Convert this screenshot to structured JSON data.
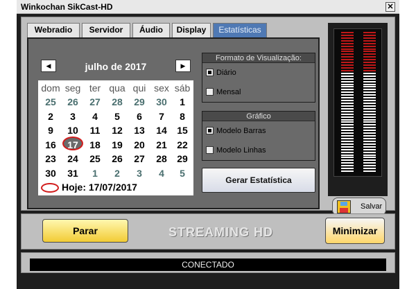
{
  "window": {
    "title": "Winkochan SikCast-HD",
    "close_icon": "close-icon"
  },
  "tabs": [
    {
      "label": "Webradio",
      "active": false
    },
    {
      "label": "Servidor",
      "active": false
    },
    {
      "label": "Áudio",
      "active": false
    },
    {
      "label": "Display",
      "active": false
    },
    {
      "label": "Estatísticas",
      "active": true
    }
  ],
  "calendar": {
    "prev_icon": "chevron-left-icon",
    "next_icon": "chevron-right-icon",
    "month": "julho de 2017",
    "weekdays": [
      "dom",
      "seg",
      "ter",
      "qua",
      "qui",
      "sex",
      "sáb"
    ],
    "weeks": [
      [
        "25",
        "26",
        "27",
        "28",
        "29",
        "30",
        "1"
      ],
      [
        "2",
        "3",
        "4",
        "5",
        "6",
        "7",
        "8"
      ],
      [
        "9",
        "10",
        "11",
        "12",
        "13",
        "14",
        "15"
      ],
      [
        "16",
        "17",
        "18",
        "19",
        "20",
        "21",
        "22"
      ],
      [
        "23",
        "24",
        "25",
        "26",
        "27",
        "28",
        "29"
      ],
      [
        "30",
        "31",
        "1",
        "2",
        "3",
        "4",
        "5"
      ]
    ],
    "today": "Hoje: 17/07/2017"
  },
  "formato": {
    "title": "Formato de Visualização:",
    "options": [
      {
        "label": "Diário",
        "checked": true
      },
      {
        "label": "Mensal",
        "checked": false
      }
    ]
  },
  "grafico": {
    "title": "Gráfico",
    "options": [
      {
        "label": "Modelo Barras",
        "checked": true
      },
      {
        "label": "Modelo Linhas",
        "checked": false
      }
    ]
  },
  "gerar_label": "Gerar Estatística",
  "vu_meter": {
    "left_level": 0.72,
    "right_level": 0.72,
    "disk_icon": "floppy-disk-icon"
  },
  "salvar_label": "Salvar",
  "parar_label": "Parar",
  "brand": "STREAMING HD",
  "minimizar_label": "Minimizar",
  "status": "CONECTADO",
  "colors": {
    "accent_tab": "#4f79b4",
    "peak_red": "#c01818",
    "level_white": "#ffffff",
    "panel_gray": "#6a6a6a"
  }
}
